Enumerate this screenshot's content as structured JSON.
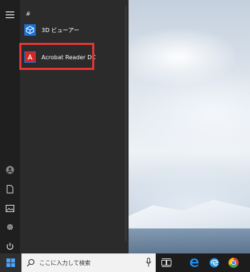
{
  "start_menu": {
    "section_letter": "#",
    "apps": [
      {
        "label": "3D ビューアー",
        "icon": "3d-viewer-icon"
      },
      {
        "label": "Acrobat Reader DC",
        "icon": "acrobat-icon"
      }
    ]
  },
  "rail": {
    "items": [
      "hamburger-icon",
      "user-icon",
      "document-icon",
      "pictures-icon",
      "settings-icon",
      "power-icon"
    ]
  },
  "taskbar": {
    "search_placeholder": "ここに入力して検索",
    "icons": [
      "task-view-icon",
      "edge-legacy-icon",
      "edge-icon",
      "chrome-icon"
    ]
  },
  "colors": {
    "accent_blue": "#1a74d9",
    "highlight_red": "#e53535",
    "acrobat_red": "#d9251d"
  }
}
